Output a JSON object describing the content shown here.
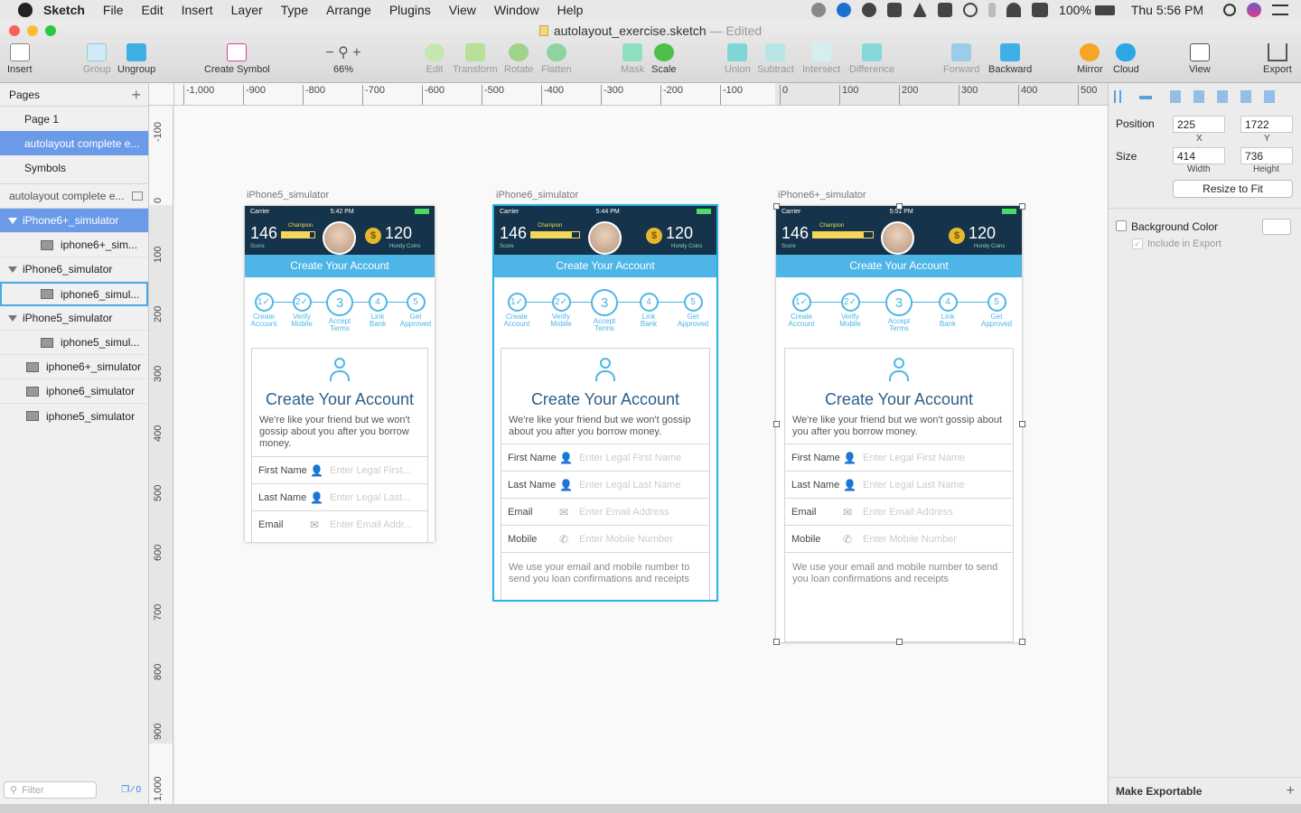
{
  "menubar": {
    "app": "Sketch",
    "items": [
      "File",
      "Edit",
      "Insert",
      "Layer",
      "Type",
      "Arrange",
      "Plugins",
      "View",
      "Window",
      "Help"
    ],
    "battery": "100%",
    "clock": "Thu 5:56 PM"
  },
  "window": {
    "filename": "autolayout_exercise.sketch",
    "status": "— Edited"
  },
  "toolbar": {
    "insert": "Insert",
    "group": "Group",
    "ungroup": "Ungroup",
    "create_symbol": "Create Symbol",
    "zoom": "66%",
    "edit": "Edit",
    "transform": "Transform",
    "rotate": "Rotate",
    "flatten": "Flatten",
    "mask": "Mask",
    "scale": "Scale",
    "union": "Union",
    "subtract": "Subtract",
    "intersect": "Intersect",
    "difference": "Difference",
    "forward": "Forward",
    "backward": "Backward",
    "mirror": "Mirror",
    "cloud": "Cloud",
    "view": "View",
    "export": "Export"
  },
  "ruler": {
    "h": [
      "-1,000",
      "-900",
      "-800",
      "-700",
      "-600",
      "-500",
      "-400",
      "-300",
      "-200",
      "-100",
      "0",
      "100",
      "200",
      "300",
      "400",
      "500"
    ],
    "v": [
      "-100",
      "0",
      "100",
      "200",
      "300",
      "400",
      "500",
      "600",
      "700",
      "800",
      "900",
      "1,000"
    ]
  },
  "sidebar": {
    "pages_title": "Pages",
    "pages": [
      "Page 1",
      "autolayout complete e...",
      "Symbols"
    ],
    "current_page": "autolayout complete e...",
    "layers": [
      {
        "label": "iPhone6+_simulator",
        "kind": "group"
      },
      {
        "label": "iphone6+_sim...",
        "kind": "image"
      },
      {
        "label": "iPhone6_simulator",
        "kind": "group"
      },
      {
        "label": "iphone6_simul...",
        "kind": "image"
      },
      {
        "label": "iPhone5_simulator",
        "kind": "group"
      },
      {
        "label": "iphone5_simul...",
        "kind": "image"
      },
      {
        "label": "iphone6+_simulator",
        "kind": "image"
      },
      {
        "label": "iphone6_simulator",
        "kind": "image"
      },
      {
        "label": "iphone5_simulator",
        "kind": "image"
      }
    ],
    "filter_placeholder": "Filter",
    "count": "0"
  },
  "artboards": [
    {
      "name": "iPhone5_simulator",
      "time": "5:42 PM",
      "carrier": "Carrier",
      "score": "146",
      "score_label": "Score",
      "champion": "Champion",
      "coins": "120",
      "coins_label": "Hundy Coins",
      "banner": "Create Your Account",
      "steps": [
        {
          "n": "1✓",
          "label": "Create\nAccount"
        },
        {
          "n": "2✓",
          "label": "Verify\nMobile"
        },
        {
          "n": "3",
          "label": "Accept\nTerms"
        },
        {
          "n": "4",
          "label": "Link\nBank"
        },
        {
          "n": "5",
          "label": "Get\nApproved"
        }
      ],
      "heading": "Create Your Account",
      "para": "We're like your friend but we won't gossip about you after you borrow money.",
      "fields": [
        {
          "key": "First Name",
          "icon": "👤",
          "placeholder": "Enter Legal First..."
        },
        {
          "key": "Last Name",
          "icon": "👤",
          "placeholder": "Enter Legal Last..."
        },
        {
          "key": "Email",
          "icon": "✉",
          "placeholder": "Enter Email Addr..."
        }
      ],
      "note": ""
    },
    {
      "name": "iPhone6_simulator",
      "time": "5:44 PM",
      "carrier": "Carrier",
      "score": "146",
      "score_label": "Score",
      "champion": "Champion",
      "coins": "120",
      "coins_label": "Hundy Coins",
      "banner": "Create Your Account",
      "steps": [
        {
          "n": "1✓",
          "label": "Create\nAccount"
        },
        {
          "n": "2✓",
          "label": "Verify\nMobile"
        },
        {
          "n": "3",
          "label": "Accept\nTerms"
        },
        {
          "n": "4",
          "label": "Link\nBank"
        },
        {
          "n": "5",
          "label": "Get\nApproved"
        }
      ],
      "heading": "Create Your Account",
      "para": "We're like your friend but we won't gossip about you after you borrow money.",
      "fields": [
        {
          "key": "First Name",
          "icon": "👤",
          "placeholder": "Enter Legal First Name"
        },
        {
          "key": "Last Name",
          "icon": "👤",
          "placeholder": "Enter Legal Last Name"
        },
        {
          "key": "Email",
          "icon": "✉",
          "placeholder": "Enter Email Address"
        },
        {
          "key": "Mobile",
          "icon": "✆",
          "placeholder": "Enter Mobile Number"
        }
      ],
      "note": "We use your email and mobile number to send you loan confirmations and receipts"
    },
    {
      "name": "iPhone6+_simulator",
      "time": "5:51 PM",
      "carrier": "Carrier",
      "score": "146",
      "score_label": "Score",
      "champion": "Champion",
      "coins": "120",
      "coins_label": "Hundy Coins",
      "banner": "Create Your Account",
      "steps": [
        {
          "n": "1✓",
          "label": "Create\nAccount"
        },
        {
          "n": "2✓",
          "label": "Verify\nMobile"
        },
        {
          "n": "3",
          "label": "Accept\nTerms"
        },
        {
          "n": "4",
          "label": "Link\nBank"
        },
        {
          "n": "5",
          "label": "Get\nApproved"
        }
      ],
      "heading": "Create Your Account",
      "para": "We're like your friend but we won't gossip about you after you borrow money.",
      "fields": [
        {
          "key": "First Name",
          "icon": "👤",
          "placeholder": "Enter Legal First Name"
        },
        {
          "key": "Last Name",
          "icon": "👤",
          "placeholder": "Enter Legal Last Name"
        },
        {
          "key": "Email",
          "icon": "✉",
          "placeholder": "Enter Email Address"
        },
        {
          "key": "Mobile",
          "icon": "✆",
          "placeholder": "Enter Mobile Number"
        }
      ],
      "note": "We use your email and mobile number to send you loan confirmations and receipts"
    }
  ],
  "inspector": {
    "position_label": "Position",
    "x": "225",
    "y": "1722",
    "x_label": "X",
    "y_label": "Y",
    "size_label": "Size",
    "w": "414",
    "h": "736",
    "w_label": "Width",
    "h_label": "Height",
    "resize_to_fit": "Resize to Fit",
    "background_color": "Background Color",
    "include_in_export": "Include in Export",
    "make_exportable": "Make Exportable"
  },
  "colors": {
    "accent": "#4db6e6",
    "header_dark": "#15334a",
    "selection_blue": "#6b9be8"
  }
}
